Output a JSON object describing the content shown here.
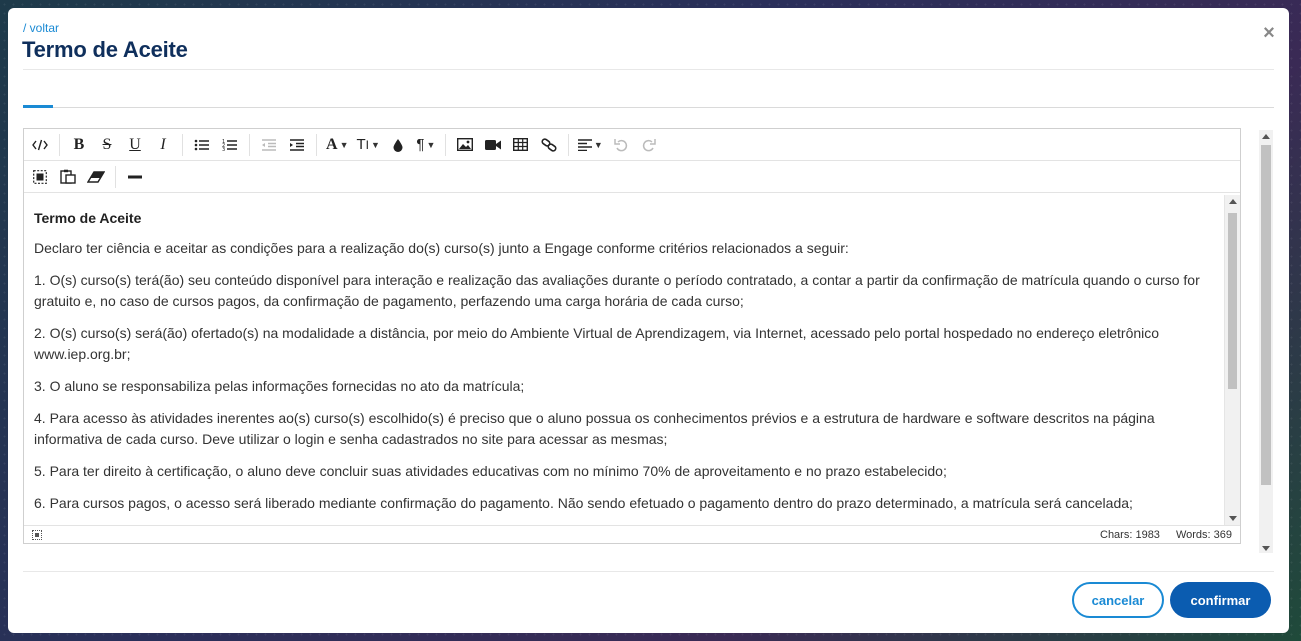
{
  "modal": {
    "back_label": "/ voltar",
    "title": "Termo de Aceite",
    "close_label": "×"
  },
  "toolbar": {
    "row1": [
      {
        "name": "code-view-icon"
      },
      {
        "name": "bold-icon"
      },
      {
        "name": "strikethrough-icon"
      },
      {
        "name": "underline-icon"
      },
      {
        "name": "italic-icon"
      },
      {
        "name": "bullet-list-icon"
      },
      {
        "name": "numbered-list-icon"
      },
      {
        "name": "outdent-icon"
      },
      {
        "name": "indent-icon"
      },
      {
        "name": "font-family-icon"
      },
      {
        "name": "font-size-icon"
      },
      {
        "name": "text-color-icon"
      },
      {
        "name": "paragraph-format-icon"
      },
      {
        "name": "insert-image-icon"
      },
      {
        "name": "insert-video-icon"
      },
      {
        "name": "insert-table-icon"
      },
      {
        "name": "insert-link-icon"
      },
      {
        "name": "align-icon"
      },
      {
        "name": "undo-icon"
      },
      {
        "name": "redo-icon"
      }
    ],
    "row2": [
      {
        "name": "select-all-icon"
      },
      {
        "name": "paste-plain-icon"
      },
      {
        "name": "clear-formatting-icon"
      },
      {
        "name": "horizontal-rule-icon"
      }
    ]
  },
  "document": {
    "title": "Termo de Aceite",
    "paragraphs": [
      "Declaro ter ciência e aceitar as condições para a realização do(s) curso(s) junto a Engage conforme critérios relacionados a seguir:",
      "1. O(s) curso(s) terá(ão) seu conteúdo disponível para interação e realização das avaliações durante o período contratado, a contar a partir da confirmação de matrícula quando o curso for gratuito e, no caso de cursos pagos, da confirmação de pagamento, perfazendo uma carga horária de cada curso;",
      "2. O(s) curso(s) será(ão) ofertado(s) na modalidade a distância, por meio do Ambiente Virtual de Aprendizagem, via Internet, acessado pelo portal hospedado no endereço eletrônico www.iep.org.br;",
      "3. O aluno se responsabiliza pelas informações fornecidas no ato da matrícula;",
      "4. Para acesso às atividades inerentes ao(s) curso(s) escolhido(s) é preciso que o aluno possua os conhecimentos prévios e a estrutura de hardware e software descritos na página informativa de cada curso. Deve utilizar o login e senha cadastrados no site para acessar as mesmas;",
      "5. Para ter direito à certificação, o aluno deve concluir suas atividades educativas com no mínimo 70% de aproveitamento e no prazo estabelecido;",
      "6. Para cursos pagos, o acesso será liberado mediante confirmação do pagamento. Não sendo efetuado o pagamento dentro do prazo determinado, a matrícula será cancelada;"
    ]
  },
  "status_bar": {
    "chars": "Chars: 1983",
    "words": "Words: 369"
  },
  "footer": {
    "cancel_label": "cancelar",
    "confirm_label": "confirmar"
  },
  "colors": {
    "accent": "#1a8ad4",
    "title": "#0f2f5c",
    "primary_button": "#0b5cb0"
  }
}
